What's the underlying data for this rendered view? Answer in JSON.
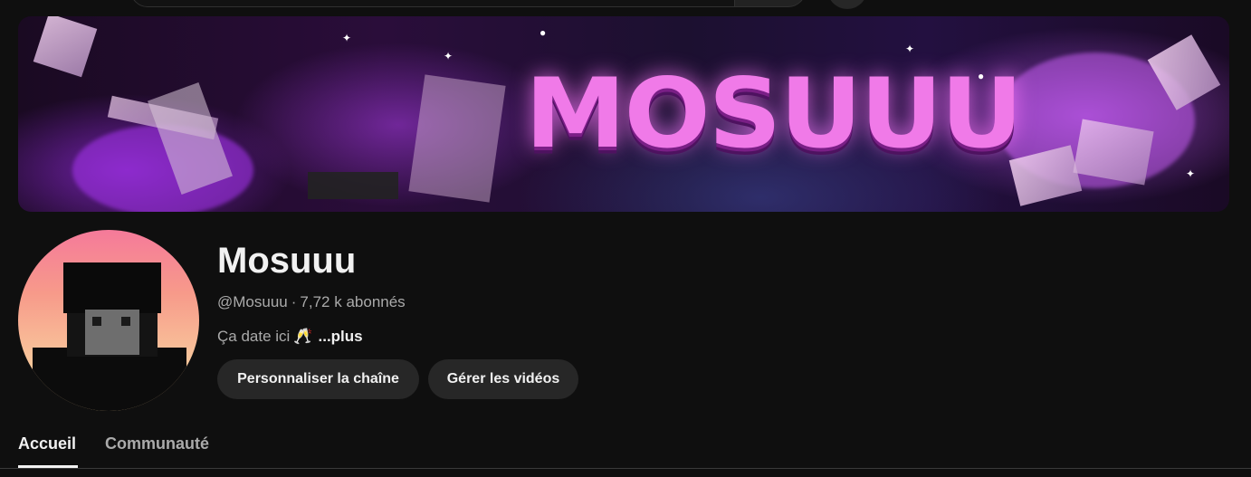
{
  "banner": {
    "title": "MOSUUU"
  },
  "channel": {
    "name": "Mosuuu",
    "handle": "@Mosuuu",
    "separator": "·",
    "subscribers": "7,72 k abonnés",
    "description": "Ça date ici",
    "description_emoji": "🥂",
    "more_label": "...plus"
  },
  "actions": {
    "customize_label": "Personnaliser la chaîne",
    "manage_label": "Gérer les vidéos"
  },
  "tabs": [
    {
      "label": "Accueil",
      "active": true
    },
    {
      "label": "Communauté",
      "active": false
    }
  ],
  "colors": {
    "background": "#0f0f0f",
    "text_primary": "#f1f1f1",
    "text_secondary": "#aaaaaa",
    "button_bg": "#272727",
    "banner_accent": "#f07ae8"
  }
}
